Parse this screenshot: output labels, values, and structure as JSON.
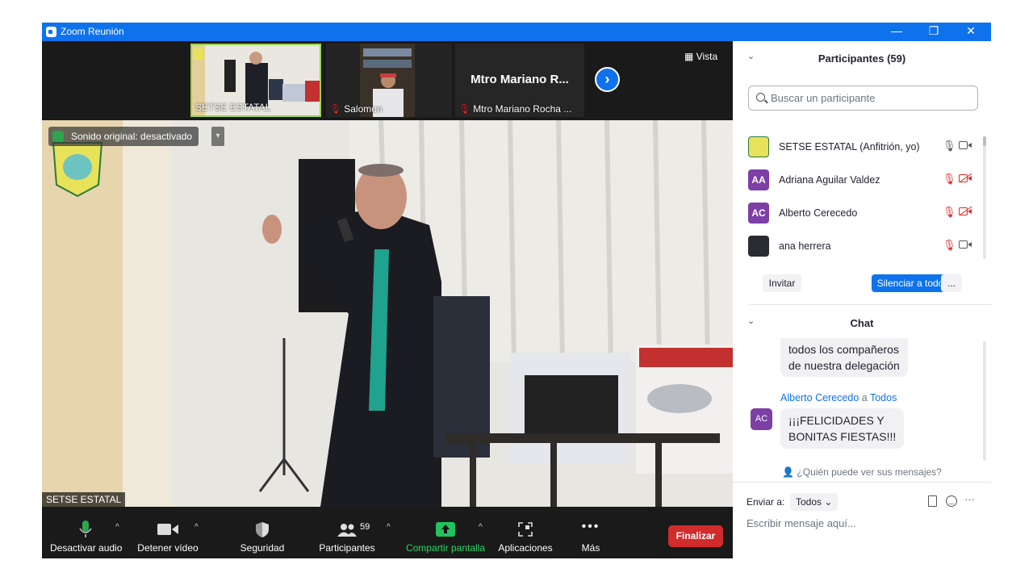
{
  "window": {
    "title": "Zoom Reunión"
  },
  "thumbnails": [
    {
      "name": "SETSE ESTATAL"
    },
    {
      "name": "Salomon"
    },
    {
      "name": "Mtro Mariano Rocha ...",
      "big_label": "Mtro  Mariano  R..."
    }
  ],
  "view_label": "Vista",
  "original_sound": "Sonido original: desactivado",
  "speaker_name": "SETSE ESTATAL",
  "toolbar": {
    "audio": "Desactivar audio",
    "video": "Detener vídeo",
    "security": "Seguridad",
    "participants": "Participantes",
    "participants_count": "59",
    "share": "Compartir pantalla",
    "apps": "Aplicaciones",
    "more": "Más",
    "end": "Finalizar"
  },
  "participants_panel": {
    "title": "Participantes (59)",
    "search_placeholder": "Buscar un participante",
    "list": [
      {
        "initials": "",
        "name": "SETSE ESTATAL (Anfitrión, yo)",
        "color": "#e8e25a",
        "mic": "on",
        "cam": "on"
      },
      {
        "initials": "AA",
        "name": "Adriana Aguilar Valdez",
        "color": "#7c3fa6",
        "mic": "off",
        "cam": "off"
      },
      {
        "initials": "AC",
        "name": "Alberto Cerecedo",
        "color": "#7c3fa6",
        "mic": "off",
        "cam": "off"
      },
      {
        "initials": "",
        "name": "ana herrera",
        "color": "#2b2b33",
        "mic": "off",
        "cam": "on"
      }
    ],
    "invite": "Invitar",
    "mute_all": "Silenciar a todos",
    "more": "..."
  },
  "chat": {
    "title": "Chat",
    "prev_message": [
      "todos los compañeros",
      "de nuestra delegación"
    ],
    "sender": "Alberto Cerecedo",
    "to_word": "a",
    "to": "Todos",
    "sender_initials": "AC",
    "message": [
      "¡¡¡FELICIDADES Y",
      "BONITAS FIESTAS!!!"
    ],
    "who_sees": "¿Quién puede ver sus mensajes?",
    "send_to_label": "Enviar a:",
    "send_to_value": "Todos",
    "input_placeholder": "Escribir mensaje aquí..."
  }
}
